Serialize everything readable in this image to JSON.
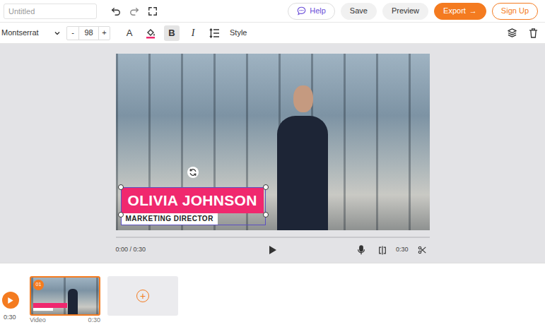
{
  "document": {
    "placeholder": "Untitled"
  },
  "header": {
    "buttons": [
      {
        "label": "Help",
        "kind": "help"
      },
      {
        "label": "Save",
        "kind": "plain"
      },
      {
        "label": "Preview",
        "kind": "plain"
      },
      {
        "label": "Export",
        "icon": "→",
        "kind": "primary"
      },
      {
        "label": "Sign Up",
        "kind": "outline"
      }
    ]
  },
  "toolbar": {
    "font": "Montserrat",
    "minus": "-",
    "size": "98",
    "plus": "+",
    "text_color": "A",
    "bold": {
      "label": "B",
      "selected": true
    },
    "italic": {
      "label": "I",
      "selected": false
    },
    "style": "Style"
  },
  "canvas": {
    "overlay": {
      "title": "OLIVIA JOHNSON",
      "subtitle": "MARKETING DIRECTOR",
      "selected": true
    }
  },
  "player": {
    "time": "0:00 / 0:30",
    "duration": "0:30",
    "progress": 0
  },
  "timeline": {
    "play_time": "0:30",
    "clips": [
      {
        "number": "01",
        "label": "Video",
        "duration": "0:30",
        "selected": true
      }
    ],
    "add": "+"
  }
}
